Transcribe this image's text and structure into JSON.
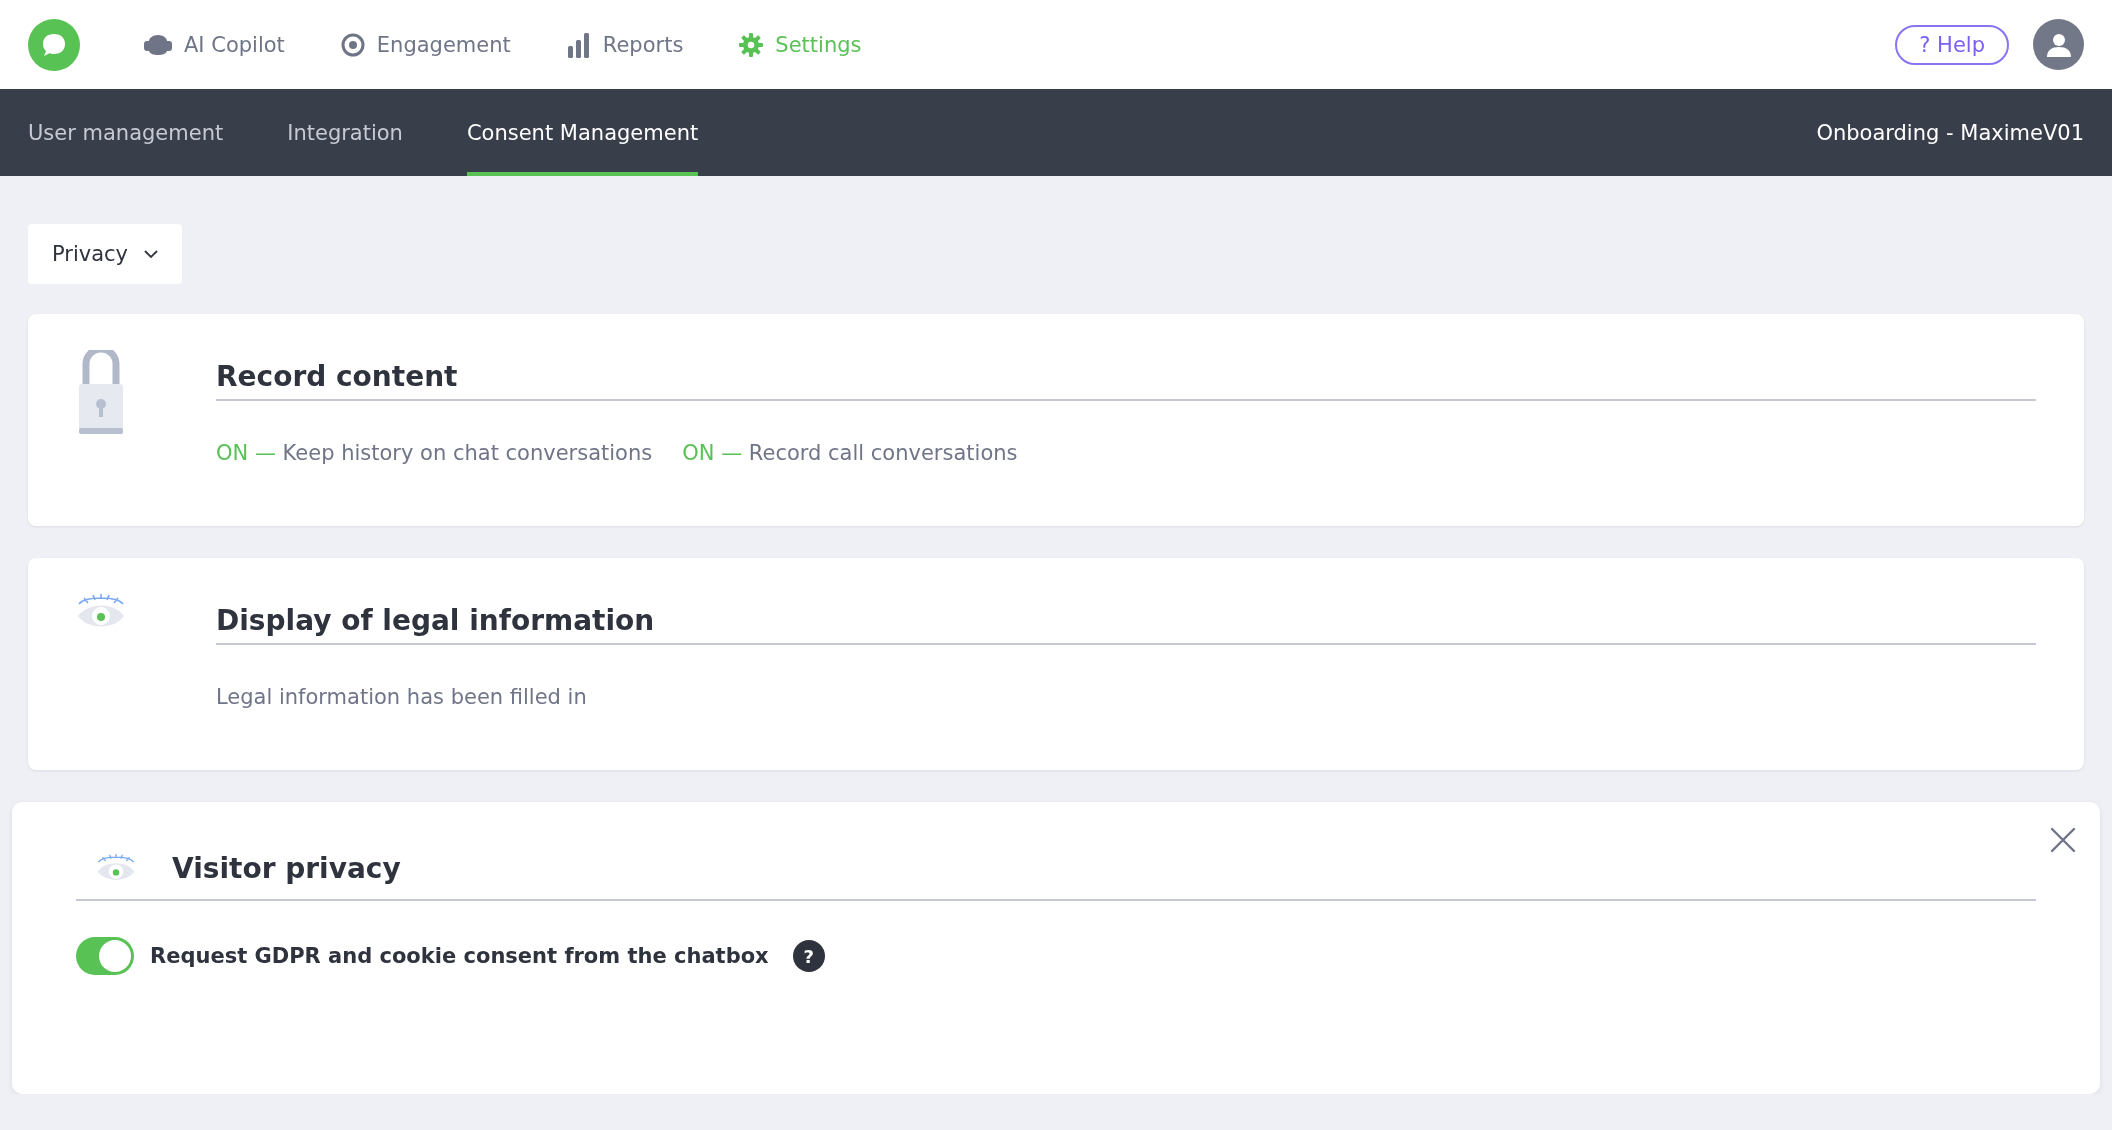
{
  "top_nav": {
    "items": [
      {
        "kind": "copilot",
        "label": "AI Copilot",
        "selected": false
      },
      {
        "kind": "engagement",
        "label": "Engagement",
        "selected": false
      },
      {
        "kind": "reports",
        "label": "Reports",
        "selected": false
      },
      {
        "kind": "settings",
        "label": "Settings",
        "selected": true
      }
    ],
    "help": "? Help"
  },
  "sub_nav": {
    "tabs": [
      {
        "label": "User management",
        "selected": false
      },
      {
        "label": "Integration",
        "selected": false
      },
      {
        "label": "Consent Management",
        "selected": true
      }
    ],
    "workspace": "Onboarding - MaximeV01"
  },
  "filter": {
    "value": "Privacy"
  },
  "cards": [
    {
      "kind": "lock",
      "title": "Record content",
      "settings": [
        {
          "status": "ON —",
          "on": true,
          "label": "Keep history on chat conversations"
        },
        {
          "status": "ON —",
          "on": true,
          "label": "Record call conversations"
        }
      ]
    },
    {
      "kind": "eye",
      "title": "Display of legal information",
      "text": "Legal information has been filled in"
    }
  ],
  "visitor_privacy": {
    "title": "Visitor privacy",
    "toggle": {
      "checked": true,
      "label": "Request GDPR and cookie consent from the chatbox"
    },
    "hint": "?"
  }
}
